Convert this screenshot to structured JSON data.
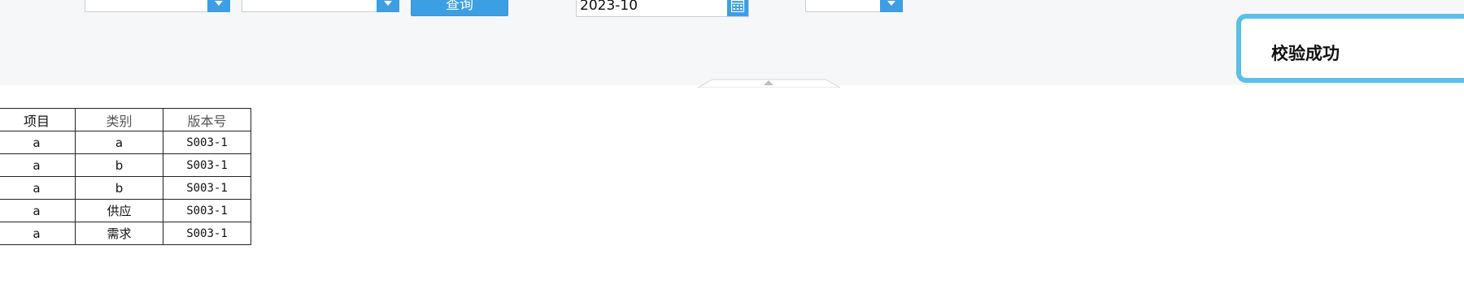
{
  "toolbar": {
    "combo1_value": "",
    "combo2_value": "",
    "query_label": "查询",
    "date_value": "2023-10",
    "combo3_value": ""
  },
  "toast": {
    "message": "校验成功"
  },
  "table": {
    "headers": [
      "项目",
      "类别",
      "版本号"
    ],
    "rows": [
      [
        "a",
        "a",
        "S003-1"
      ],
      [
        "a",
        "b",
        "S003-1"
      ],
      [
        "a",
        "b",
        "S003-1"
      ],
      [
        "a",
        "供应",
        "S003-1"
      ],
      [
        "a",
        "需求",
        "S003-1"
      ]
    ]
  },
  "colors": {
    "accent": "#3d9fe3",
    "toast_border": "#5ac0e6",
    "toolbar_bg": "#f6f7f9"
  }
}
